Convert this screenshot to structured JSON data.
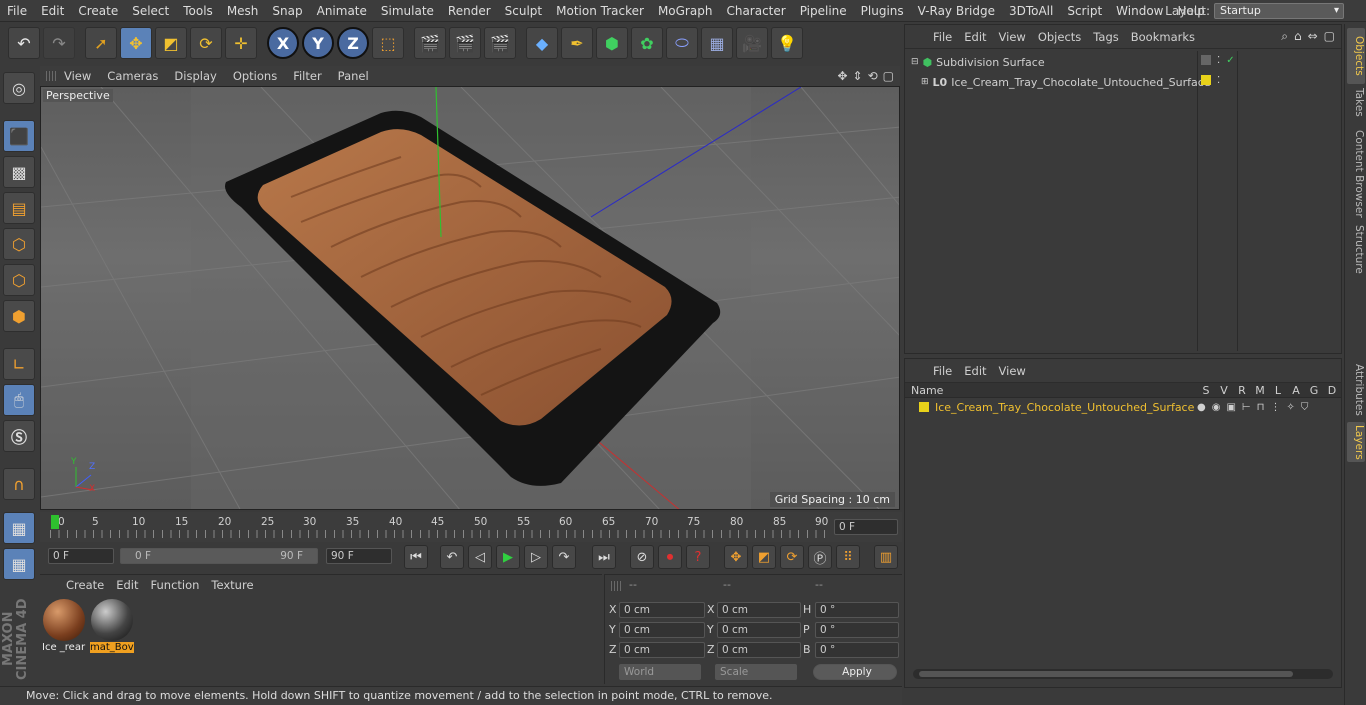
{
  "menubar": {
    "items": [
      "File",
      "Edit",
      "Create",
      "Select",
      "Tools",
      "Mesh",
      "Snap",
      "Animate",
      "Simulate",
      "Render",
      "Sculpt",
      "Motion Tracker",
      "MoGraph",
      "Character",
      "Pipeline",
      "Plugins",
      "V-Ray Bridge",
      "3DToAll",
      "Script",
      "Window",
      "Help"
    ],
    "layout_label": "Layout:",
    "layout_value": "Startup"
  },
  "toolbar": {
    "axis_x": "X",
    "axis_y": "Y",
    "axis_z": "Z"
  },
  "viewport": {
    "menu": [
      "View",
      "Cameras",
      "Display",
      "Options",
      "Filter",
      "Panel"
    ],
    "label": "Perspective",
    "grid_spacing": "Grid Spacing : 10 cm",
    "axis_y": "Y",
    "axis_z": "Z",
    "axis_x": "X"
  },
  "timeline": {
    "ticks": [
      "0",
      "5",
      "10",
      "15",
      "20",
      "25",
      "30",
      "35",
      "40",
      "45",
      "50",
      "55",
      "60",
      "65",
      "70",
      "75",
      "80",
      "85",
      "90"
    ],
    "current_frame": "0 F"
  },
  "controls": {
    "start_field": "0 F",
    "range_start": "0 F",
    "range_end": "90 F",
    "end_field": "90 F"
  },
  "material_panel": {
    "menu": [
      "Create",
      "Edit",
      "Function",
      "Texture"
    ],
    "materials": [
      {
        "label": "Ice _rear"
      },
      {
        "label": "mat_Bov"
      }
    ]
  },
  "coordinates": {
    "header": [
      "--",
      "--",
      "--"
    ],
    "rows": [
      {
        "a": "X",
        "av": "0 cm",
        "b": "X",
        "bv": "0 cm",
        "c": "H",
        "cv": "0 °"
      },
      {
        "a": "Y",
        "av": "0 cm",
        "b": "Y",
        "bv": "0 cm",
        "c": "P",
        "cv": "0 °"
      },
      {
        "a": "Z",
        "av": "0 cm",
        "b": "Z",
        "bv": "0 cm",
        "c": "B",
        "cv": "0 °"
      }
    ],
    "mode": "World",
    "scale": "Scale",
    "apply": "Apply"
  },
  "status": "Move: Click and drag to move elements. Hold down SHIFT to quantize movement / add to the selection in point mode, CTRL to remove.",
  "objects_panel": {
    "menu": [
      "File",
      "Edit",
      "View",
      "Objects",
      "Tags",
      "Bookmarks"
    ],
    "items": [
      {
        "name": "Subdivision Surface"
      },
      {
        "name": "Ice_Cream_Tray_Chocolate_Untouched_Surface"
      }
    ]
  },
  "layers_panel": {
    "menu": [
      "File",
      "Edit",
      "View"
    ],
    "name_header": "Name",
    "cols": [
      "S",
      "V",
      "R",
      "M",
      "L",
      "A",
      "G",
      "D"
    ],
    "layer_name": "Ice_Cream_Tray_Chocolate_Untouched_Surface"
  },
  "side_tabs": [
    "Objects",
    "Takes",
    "Content Browser",
    "Structure",
    "Attributes",
    "Layers"
  ],
  "colors": {
    "accent": "#5b82b8",
    "layer_yellow": "#e8d21a",
    "chocolate": "#a0633a"
  }
}
